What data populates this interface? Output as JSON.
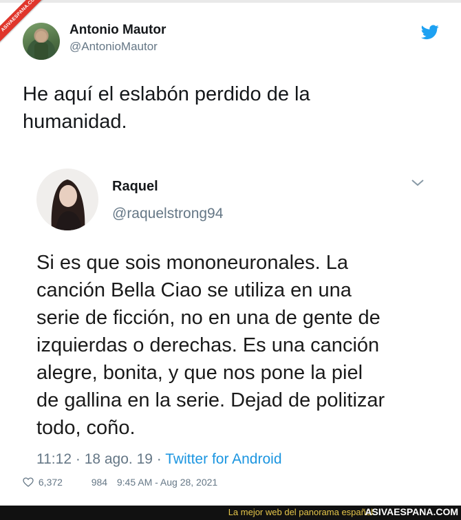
{
  "watermark": {
    "ribbon_text": "ASIVAESPANA.COM"
  },
  "author": {
    "name": "Antonio Mautor",
    "handle": "@AntonioMautor",
    "avatar_icon": "user-avatar",
    "platform_icon": "twitter-bird-icon"
  },
  "tweet": {
    "text_line1": "He aquí el eslabón perdido de la",
    "text_line2": "humanidad."
  },
  "quoted": {
    "name": "Raquel",
    "handle": "@raquelstrong94",
    "menu_icon": "chevron-down-icon",
    "lines": [
      "Si es que sois mononeuronales. La",
      "canción Bella Ciao se utiliza en una",
      "serie de ficción, no en una de gente de",
      "izquierdas o derechas. Es una canción",
      "alegre, bonita, y que nos pone la piel",
      "de gallina en la serie. Dejad de politizar",
      "todo, coño."
    ],
    "time": "11:12",
    "date": "18 ago. 19",
    "source": "Twitter for Android",
    "separator": "·"
  },
  "stats": {
    "likes": "6,372",
    "retweets": "984",
    "timestamp": "9:45 AM - Aug 28, 2021"
  },
  "footer": {
    "slogan": "La mejor web del panorama español",
    "site": "ASIVAESPANA.COM"
  },
  "colors": {
    "accent": "#1da1f2",
    "text": "#14171a",
    "muted": "#657786",
    "bar": "#111111",
    "slogan": "#e6c64a"
  }
}
